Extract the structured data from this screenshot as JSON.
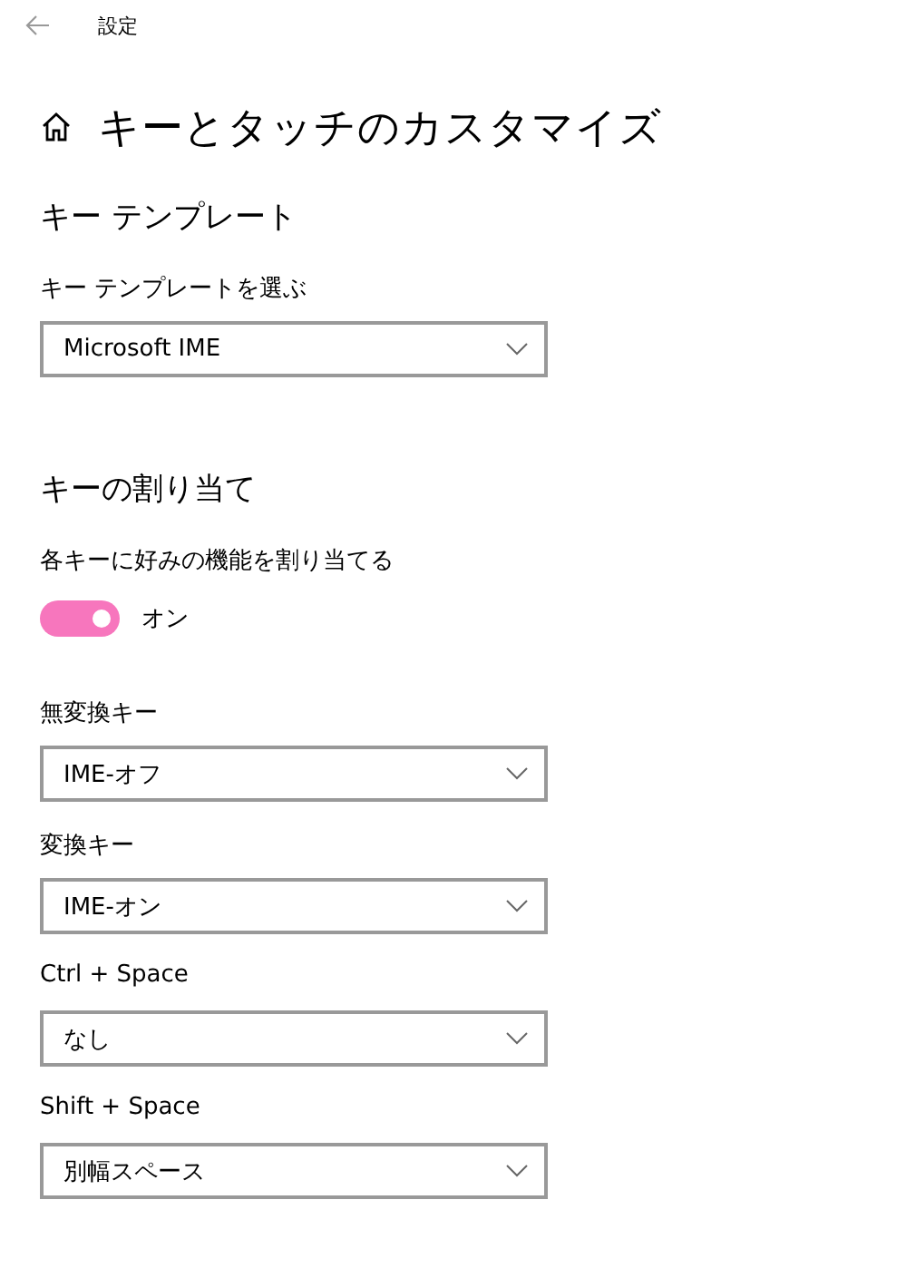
{
  "window": {
    "title": "設定"
  },
  "page": {
    "title": "キーとタッチのカスタマイズ"
  },
  "template_section": {
    "heading": "キー テンプレート",
    "label": "キー テンプレートを選ぶ",
    "value": "Microsoft IME"
  },
  "assign_section": {
    "heading": "キーの割り当て",
    "toggle": {
      "label": "各キーに好みの機能を割り当てる",
      "on": true,
      "state_text": "オン"
    },
    "keys": [
      {
        "label": "無変換キー",
        "value": "IME-オフ"
      },
      {
        "label": "変換キー",
        "value": "IME-オン"
      },
      {
        "label": "Ctrl + Space",
        "value": "なし"
      },
      {
        "label": "Shift + Space",
        "value": "別幅スペース"
      }
    ]
  }
}
